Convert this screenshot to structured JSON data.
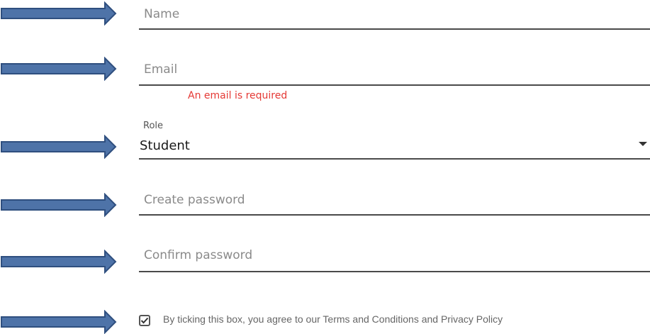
{
  "form": {
    "name_field": {
      "placeholder": "Name",
      "value": ""
    },
    "email_field": {
      "placeholder": "Email",
      "value": "",
      "error": "An email is required"
    },
    "role_select": {
      "label": "Role",
      "selected": "Student"
    },
    "create_password_field": {
      "placeholder": "Create password",
      "value": ""
    },
    "confirm_password_field": {
      "placeholder": "Confirm password",
      "value": ""
    },
    "terms_checkbox": {
      "label": "By ticking this box, you agree to our Terms and Conditions and Privacy Policy",
      "checked": true
    }
  },
  "colors": {
    "arrow_fill": "#4e73a8",
    "arrow_stroke": "#2f4f7f",
    "error": "#e53935",
    "underline": "#4a4a4a"
  },
  "icons": {
    "arrow": "arrow-right-icon",
    "dropdown": "caret-down-icon",
    "check": "check-icon"
  }
}
